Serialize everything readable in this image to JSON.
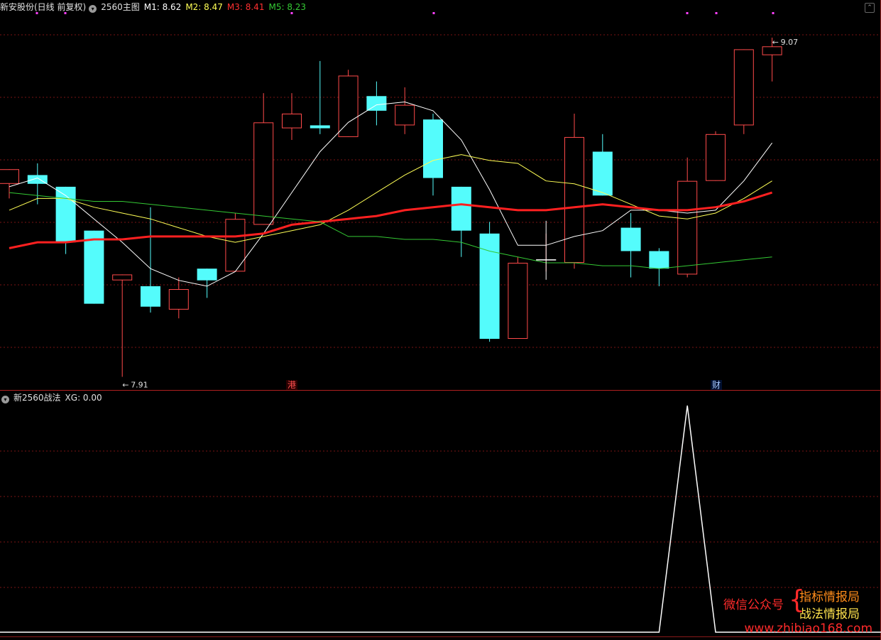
{
  "header": {
    "stock": "新安股份(日线 前复权)",
    "indicator": "2560主图",
    "m1": "M1: 8.62",
    "m2": "M2: 8.47",
    "m3": "M3: 8.41",
    "m5": "M5: 8.23"
  },
  "sub_header": {
    "name": "新2560战法",
    "xg": "XG: 0.00"
  },
  "markers": {
    "gang": "港",
    "cai": "财"
  },
  "watermark": {
    "label": "微信公众号",
    "line1": "指标情报局",
    "line2": "战法情报局",
    "url": "www.zhibiao168.com"
  },
  "colors": {
    "up": "#ff4a4a",
    "down": "#54fcfc",
    "m1": "#ffffff",
    "m2": "#ffff55",
    "m3": "#ff2020",
    "m5": "#34c934",
    "grid": "#7a1414"
  },
  "chart_data": [
    {
      "type": "candlestick",
      "title": "2560主图",
      "ylim": [
        7.87,
        9.15
      ],
      "annotations": [
        {
          "label": "7.91",
          "value": 7.91
        },
        {
          "label": "9.07",
          "value": 9.07
        }
      ],
      "candles": [
        {
          "open": 8.57,
          "close": 8.62,
          "high": 8.62,
          "low": 8.52
        },
        {
          "open": 8.6,
          "close": 8.57,
          "high": 8.64,
          "low": 8.5
        },
        {
          "open": 8.56,
          "close": 8.37,
          "high": 8.56,
          "low": 8.33
        },
        {
          "open": 8.41,
          "close": 8.16,
          "high": 8.41,
          "low": 8.16
        },
        {
          "open": 8.24,
          "close": 8.26,
          "high": 8.26,
          "low": 7.91
        },
        {
          "open": 8.22,
          "close": 8.15,
          "high": 8.49,
          "low": 8.13
        },
        {
          "open": 8.14,
          "close": 8.21,
          "high": 8.25,
          "low": 8.11
        },
        {
          "open": 8.28,
          "close": 8.24,
          "high": 8.28,
          "low": 8.18
        },
        {
          "open": 8.27,
          "close": 8.45,
          "high": 8.47,
          "low": 8.27
        },
        {
          "open": 8.43,
          "close": 8.78,
          "high": 8.88,
          "low": 8.43
        },
        {
          "open": 8.76,
          "close": 8.81,
          "high": 8.88,
          "low": 8.72
        },
        {
          "open": 8.77,
          "close": 8.76,
          "high": 8.99,
          "low": 8.74
        },
        {
          "open": 8.73,
          "close": 8.94,
          "high": 8.96,
          "low": 8.73
        },
        {
          "open": 8.87,
          "close": 8.82,
          "high": 8.92,
          "low": 8.77
        },
        {
          "open": 8.77,
          "close": 8.84,
          "high": 8.9,
          "low": 8.74
        },
        {
          "open": 8.79,
          "close": 8.59,
          "high": 8.81,
          "low": 8.53
        },
        {
          "open": 8.56,
          "close": 8.41,
          "high": 8.56,
          "low": 8.32
        },
        {
          "open": 8.4,
          "close": 8.04,
          "high": 8.44,
          "low": 8.03
        },
        {
          "open": 8.04,
          "close": 8.3,
          "high": 8.32,
          "low": 8.04
        },
        {
          "open": 8.31,
          "close": 8.31,
          "high": 8.4,
          "low": 8.27
        },
        {
          "open": 8.3,
          "close": 8.73,
          "high": 8.81,
          "low": 8.28
        },
        {
          "open": 8.68,
          "close": 8.53,
          "high": 8.74,
          "low": 8.53
        },
        {
          "open": 8.42,
          "close": 8.34,
          "high": 8.47,
          "low": 8.25
        },
        {
          "open": 8.34,
          "close": 8.28,
          "high": 8.35,
          "low": 8.22
        },
        {
          "open": 8.26,
          "close": 8.58,
          "high": 8.66,
          "low": 8.25
        },
        {
          "open": 8.58,
          "close": 8.74,
          "high": 8.75,
          "low": 8.58
        },
        {
          "open": 8.77,
          "close": 9.03,
          "high": 9.03,
          "low": 8.74
        },
        {
          "open": 9.01,
          "close": 9.04,
          "high": 9.07,
          "low": 8.92
        }
      ],
      "series": [
        {
          "name": "M1",
          "values": [
            8.56,
            8.59,
            8.53,
            8.45,
            8.37,
            8.28,
            8.24,
            8.22,
            8.27,
            8.4,
            8.54,
            8.68,
            8.78,
            8.84,
            8.85,
            8.82,
            8.72,
            8.55,
            8.36,
            8.36,
            8.39,
            8.41,
            8.48,
            8.48,
            8.47,
            8.48,
            8.58,
            8.71
          ]
        },
        {
          "name": "M2",
          "values": [
            8.48,
            8.52,
            8.52,
            8.49,
            8.47,
            8.45,
            8.42,
            8.39,
            8.37,
            8.39,
            8.41,
            8.43,
            8.48,
            8.54,
            8.6,
            8.65,
            8.67,
            8.65,
            8.64,
            8.58,
            8.57,
            8.54,
            8.5,
            8.46,
            8.45,
            8.47,
            8.52,
            8.58
          ]
        },
        {
          "name": "M3",
          "values": [
            8.35,
            8.37,
            8.37,
            8.38,
            8.38,
            8.39,
            8.39,
            8.39,
            8.39,
            8.4,
            8.43,
            8.44,
            8.45,
            8.46,
            8.48,
            8.49,
            8.5,
            8.49,
            8.48,
            8.48,
            8.49,
            8.5,
            8.49,
            8.48,
            8.48,
            8.49,
            8.51,
            8.54
          ]
        },
        {
          "name": "M5",
          "values": [
            8.54,
            8.53,
            8.52,
            8.51,
            8.51,
            8.5,
            8.49,
            8.48,
            8.47,
            8.46,
            8.45,
            8.44,
            8.39,
            8.39,
            8.38,
            8.38,
            8.37,
            8.34,
            8.32,
            8.3,
            8.3,
            8.29,
            8.29,
            8.28,
            8.29,
            8.3,
            8.31,
            8.32
          ]
        }
      ]
    },
    {
      "type": "line",
      "title": "新2560战法",
      "ylim": [
        0,
        1
      ],
      "series": [
        {
          "name": "XG",
          "values": [
            0,
            0,
            0,
            0,
            0,
            0,
            0,
            0,
            0,
            0,
            0,
            0,
            0,
            0,
            0,
            0,
            0,
            0,
            0,
            0,
            0,
            0,
            0,
            0,
            1,
            0,
            0,
            0
          ]
        }
      ]
    }
  ]
}
